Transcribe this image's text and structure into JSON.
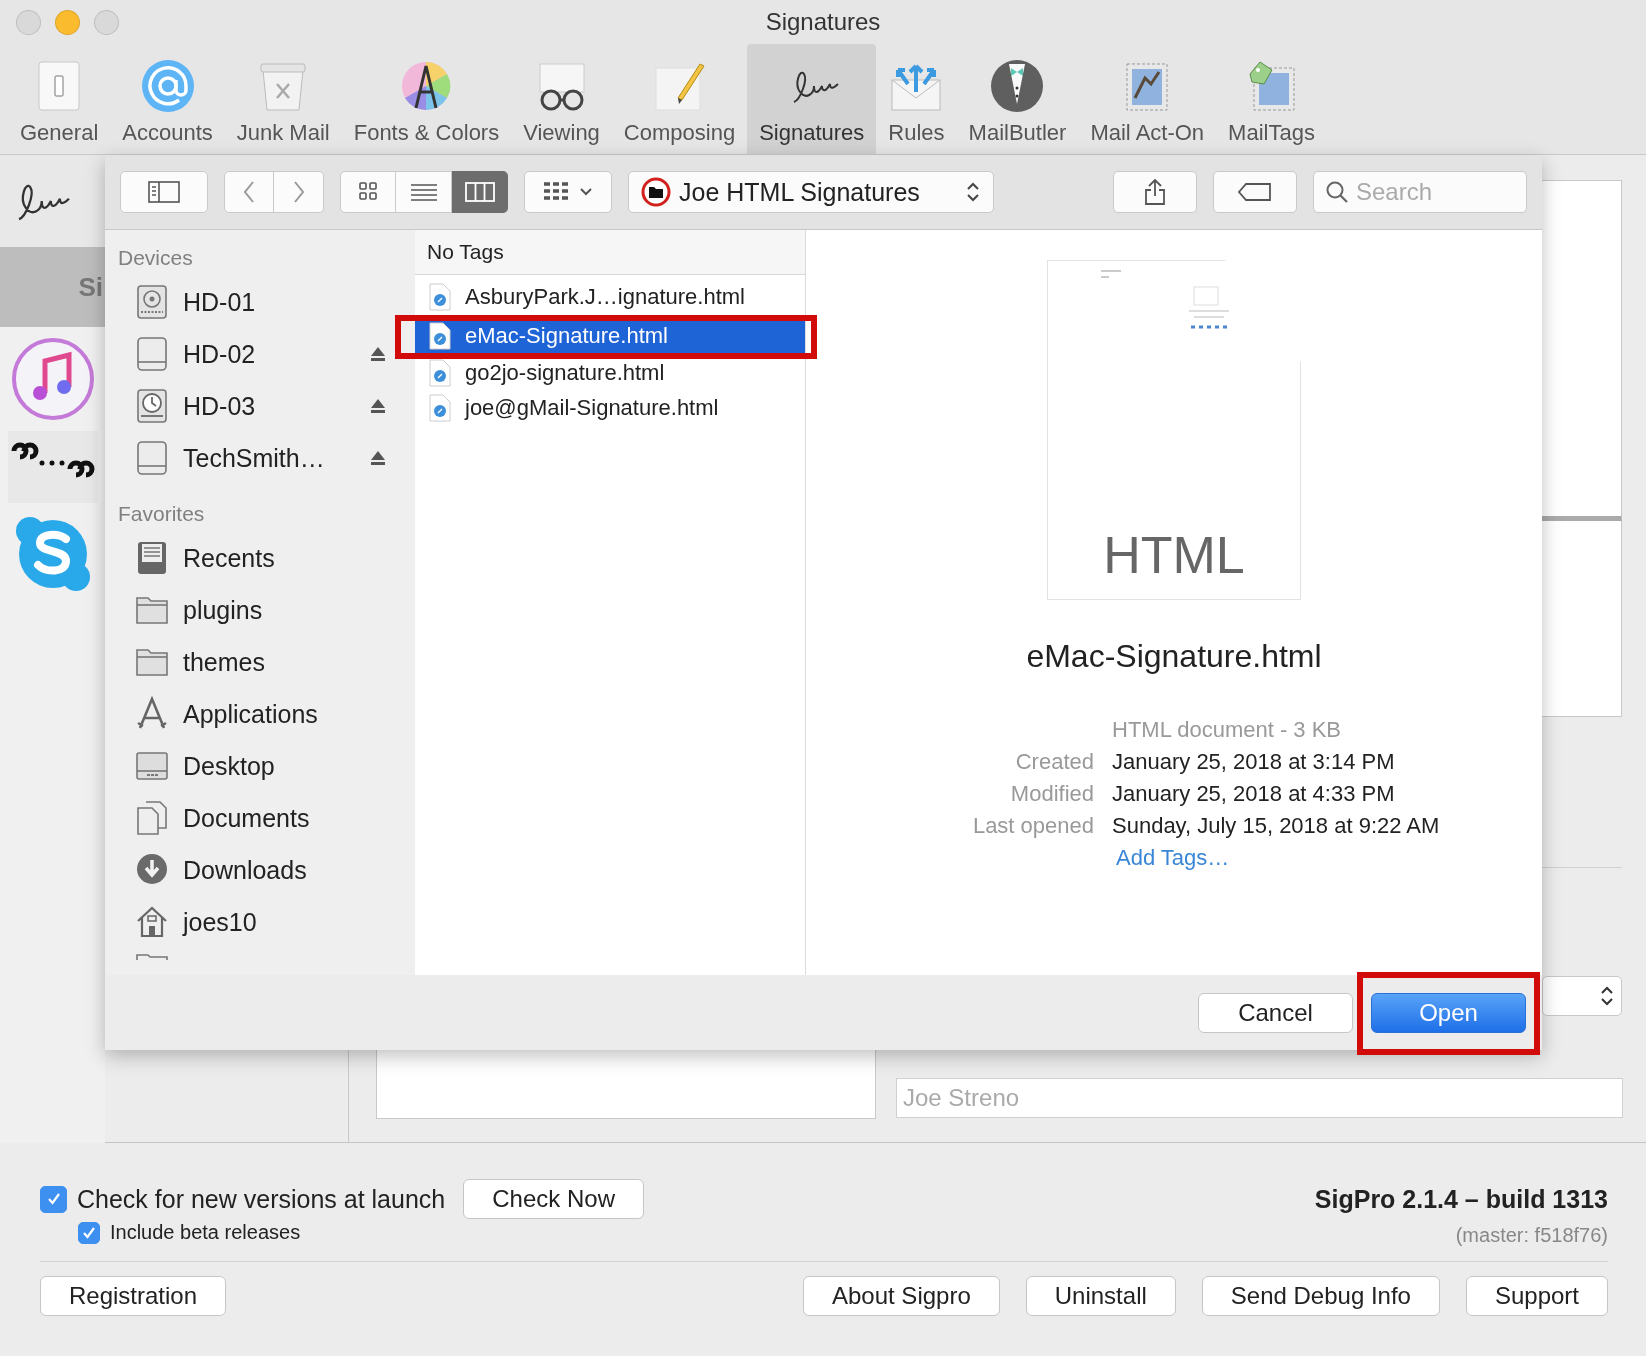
{
  "window": {
    "title": "Signatures"
  },
  "toolbar": [
    {
      "label": "General",
      "selected": false
    },
    {
      "label": "Accounts",
      "selected": false
    },
    {
      "label": "Junk Mail",
      "selected": false
    },
    {
      "label": "Fonts & Colors",
      "selected": false
    },
    {
      "label": "Viewing",
      "selected": false
    },
    {
      "label": "Composing",
      "selected": false
    },
    {
      "label": "Signatures",
      "selected": true
    },
    {
      "label": "Rules",
      "selected": false
    },
    {
      "label": "MailButler",
      "selected": false
    },
    {
      "label": "Mail Act-On",
      "selected": false
    },
    {
      "label": "MailTags",
      "selected": false
    }
  ],
  "background": {
    "side_label": "Si",
    "name_field": {
      "placeholder": "Joe Streno"
    }
  },
  "dialog": {
    "toolbar": {
      "view_modes": [
        {
          "selected": false
        },
        {
          "selected": false
        },
        {
          "selected": true
        }
      ],
      "location": "Joe HTML Signatures",
      "search": {
        "placeholder": "Search"
      }
    },
    "sidebar": [
      {
        "title": "Devices",
        "items": [
          {
            "label": "HD-01",
            "kind": "disc-drive",
            "ejectable": false
          },
          {
            "label": "HD-02",
            "kind": "drive",
            "ejectable": true
          },
          {
            "label": "HD-03",
            "kind": "backup-drive",
            "ejectable": true
          },
          {
            "label": "TechSmith…",
            "kind": "drive",
            "ejectable": true
          }
        ]
      },
      {
        "title": "Favorites",
        "items": [
          {
            "label": "Recents",
            "kind": "recents",
            "ejectable": false
          },
          {
            "label": "plugins",
            "kind": "folder",
            "ejectable": false
          },
          {
            "label": "themes",
            "kind": "folder",
            "ejectable": false
          },
          {
            "label": "Applications",
            "kind": "apps",
            "ejectable": false
          },
          {
            "label": "Desktop",
            "kind": "desktop",
            "ejectable": false
          },
          {
            "label": "Documents",
            "kind": "documents",
            "ejectable": false
          },
          {
            "label": "Downloads",
            "kind": "downloads",
            "ejectable": false
          },
          {
            "label": "joes10",
            "kind": "home",
            "ejectable": false
          }
        ]
      }
    ],
    "column": {
      "header": "No Tags",
      "files": [
        {
          "name": "AsburyPark.J…ignature.html",
          "selected": false,
          "highlighted": false
        },
        {
          "name": "eMac-Signature.html",
          "selected": true,
          "highlighted": true
        },
        {
          "name": "go2jo-signature.html",
          "selected": false,
          "highlighted": false
        },
        {
          "name": "joe@gMail-Signature.html",
          "selected": false,
          "highlighted": false
        }
      ]
    },
    "preview": {
      "type_label": "HTML",
      "filename": "eMac-Signature.html",
      "summary": "HTML document - 3 KB",
      "info": [
        {
          "label": "Created",
          "value": "January 25, 2018 at 3:14 PM"
        },
        {
          "label": "Modified",
          "value": "January 25, 2018 at 4:33 PM"
        },
        {
          "label": "Last opened",
          "value": "Sunday, July 15, 2018 at 9:22 AM"
        }
      ],
      "add_tags": "Add Tags…"
    },
    "buttons": [
      {
        "label": "Cancel",
        "default": false,
        "highlighted": false
      },
      {
        "label": "Open",
        "default": true,
        "highlighted": true
      }
    ]
  },
  "footer": {
    "checks": [
      {
        "label": "Check for new versions at launch",
        "checked": true
      },
      {
        "label": "Include beta releases",
        "checked": true
      }
    ],
    "check_now": "Check Now",
    "version": "SigPro 2.1.4 – build 1313",
    "build": "(master: f518f76)",
    "buttons": [
      "Registration",
      "About Sigpro",
      "Uninstall",
      "Send Debug Info",
      "Support"
    ]
  }
}
